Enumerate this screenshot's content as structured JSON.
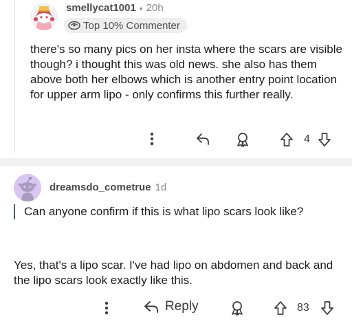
{
  "comments": [
    {
      "username": "smellycat1001",
      "separator": "•",
      "time": "20h",
      "badge": "Top 10% Commenter",
      "body": "there's so many pics on her insta where the scars are visible though? i thought this was old news. she also has them above both her elbows which is another entry point location for upper arm lipo - only confirms this further really.",
      "actions": {
        "more_icon": "vertical-dots-icon",
        "reply_icon": "reply-arrow-icon",
        "award_icon": "award-icon",
        "upvote_icon": "upvote-arrow-icon",
        "vote_count": "4",
        "downvote_icon": "downvote-arrow-icon"
      }
    },
    {
      "username": "dreamsdo_cometrue",
      "time": "1d",
      "quote": "Can anyone confirm if this is what lipo scars look like?",
      "body": "Yes, that's a lipo scar. I've had lipo on abdomen and back and the lipo scars look exactly like this.",
      "actions": {
        "more_icon": "vertical-dots-icon",
        "reply_icon": "reply-arrow-icon",
        "reply_label": "Reply",
        "award_icon": "award-icon",
        "upvote_icon": "upvote-arrow-icon",
        "vote_count": "83",
        "downvote_icon": "downvote-arrow-icon"
      }
    }
  ],
  "colors": {
    "quote_bar": "#4c5a6e",
    "divider": "#f1f1f1",
    "avatar2_bg": "#d9c6f4"
  }
}
